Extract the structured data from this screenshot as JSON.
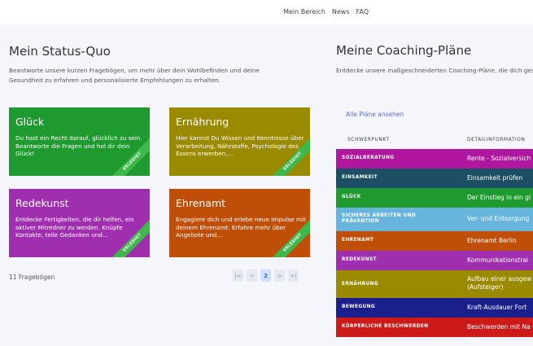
{
  "nav": {
    "items": [
      "Mein Bereich",
      "News",
      "FAQ"
    ]
  },
  "status_quo": {
    "title": "Mein Status-Quo",
    "intro": "Beantworte unsere kurzen Fragebögen, um mehr über dein Wohlbefinden und deine Gesundheit zu erfahren und personalisierte Empfehlungen zu erhalten.",
    "cards": [
      {
        "title": "Glück",
        "desc": "Du hast ein Recht darauf, glücklich zu sein. Beantworte die Fragen und hol dir dein Glück!",
        "badge": "ERLEDIGT",
        "color": "#1f9a2f"
      },
      {
        "title": "Ernährung",
        "desc": "Hier kannst Du Wissen und Kenntnisse über Verarbeitung, Nährstoffe, Psychologie des Essens erwerben,...",
        "badge": "ERLEDIGT",
        "color": "#9a8a00"
      },
      {
        "title": "Redekunst",
        "desc": "Entdecke Fertigkeiten, die dir helfen, ein aktiver Mitredner zu werden. Knüpfe Kontakte, teile Gedanken und...",
        "badge": "ERLEDIGT",
        "color": "#a02fb0"
      },
      {
        "title": "Ehrenamt",
        "desc": "Engagiere dich und erlebe neue Impulse mit deinem Ehrenamt. Erfahre mehr über Angebote und...",
        "badge": "ERLEDIGT",
        "color": "#bf4f08"
      }
    ],
    "count_text": "11 Fragebögen",
    "pagination": {
      "first": "|<",
      "prev": "<",
      "current": "2",
      "next": ">",
      "last": ">|"
    }
  },
  "coaching": {
    "title": "Meine Coaching-Pläne",
    "intro": "Entdecke unsere maßgeschneiderten Coaching-Pläne, die dich gesünderen Lebensstil unterstützen. Erreiche deine Ziele mit Empfehlungen und einem persönlichen Betreuungsplan.",
    "all_link": "Alle Pläne ansehen",
    "headers": {
      "focus": "SCHWERPUNKT",
      "detail": "DETAILINFORMATION"
    },
    "rows": [
      {
        "focus": "SOZIALBERATUNG",
        "detail": "Rente - Sozialversich",
        "color": "#b0179f"
      },
      {
        "focus": "EINSAMKEIT",
        "detail": "Einsamkeit prüfen",
        "color": "#1c4f63"
      },
      {
        "focus": "GLÜCK",
        "detail": "Der Einstieg in ein gl",
        "color": "#1f9a2f"
      },
      {
        "focus": "SICHERES ARBEITEN UND PRÄVENTION",
        "detail": "Ver- und Entsorgung",
        "color": "#67b4dd"
      },
      {
        "focus": "EHRENAMT",
        "detail": "Ehrenamt Berlin",
        "color": "#bf4f08"
      },
      {
        "focus": "REDEKUNST",
        "detail": "Kommunikationstrai",
        "color": "#a02fb0"
      },
      {
        "focus": "ERNÄHRUNG",
        "detail": "Aufbau einer ausgew\n(Aufsteiger)",
        "color": "#9a8a00"
      },
      {
        "focus": "BEWEGUNG",
        "detail": "Kraft-Ausdauer Fort",
        "color": "#1b1f8c"
      },
      {
        "focus": "KÖRPERLICHE BESCHWERDEN",
        "detail": "Beschwerden mit Na",
        "color": "#cc1a18"
      }
    ]
  }
}
